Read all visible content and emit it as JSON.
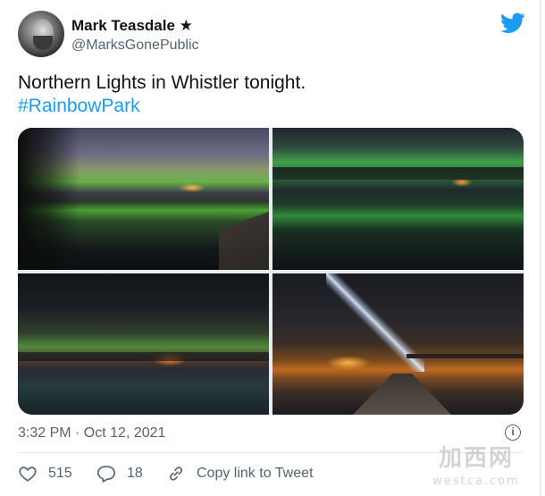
{
  "author": {
    "name": "Mark Teasdale ★",
    "handle": "@MarksGonePublic"
  },
  "icons": {
    "brand": "twitter-bird-icon",
    "info": "info-icon",
    "like": "heart-icon",
    "reply": "reply-bubble-icon",
    "copy": "link-icon"
  },
  "colors": {
    "accent": "#1d9bf0",
    "text": "#0f1419",
    "secondary": "#536471"
  },
  "tweet": {
    "text": "Northern Lights in Whistler tonight.",
    "hashtag": "#RainbowPark"
  },
  "media": {
    "photos": [
      "northern-lights-lake-dock",
      "northern-lights-green-reflection",
      "northern-lights-foggy-town",
      "flashlight-beam-dock-night"
    ]
  },
  "meta": {
    "timestamp": "3:32 PM · Oct 12, 2021",
    "info_symbol": "i"
  },
  "actions": {
    "likes": "515",
    "replies": "18",
    "copy_label": "Copy link to Tweet"
  },
  "watermark": {
    "main": "加西网",
    "sub": "westca.com"
  }
}
